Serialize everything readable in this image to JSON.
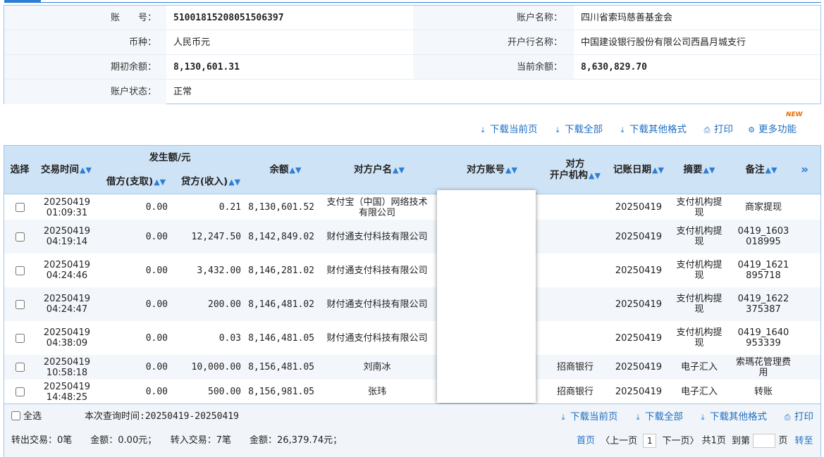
{
  "account_info": {
    "account_no_label": "账　　号：",
    "account_no": "51001815208051506397",
    "account_name_label": "账户名称：",
    "account_name": "四川省索玛慈善基金会",
    "currency_label": "币种：",
    "currency": "人民币元",
    "bank_label": "开户行名称：",
    "bank": "中国建设银行股份有限公司西昌月城支行",
    "opening_balance_label": "期初余额：",
    "opening_balance": "8,130,601.31",
    "current_balance_label": "当前余额：",
    "current_balance": "8,630,829.70",
    "status_label": "账户状态：",
    "status": "正常"
  },
  "toolbar_top": {
    "download_page": "下载当前页",
    "download_all": "下载全部",
    "download_other": "下载其他格式",
    "print": "打印",
    "more": "更多功能",
    "new_badge": "NEW"
  },
  "table": {
    "headers": {
      "select": "选择",
      "time": "交易时间",
      "amount_group": "发生额/元",
      "debit": "借方(支取)",
      "credit": "贷方(收入)",
      "balance": "余额",
      "counterparty": "对方户名",
      "counter_account": "对方账号",
      "counter_bank_1": "对方",
      "counter_bank_2": "开户机构",
      "post_date": "记账日期",
      "summary": "摘要",
      "remark": "备注"
    },
    "rows": [
      {
        "date": "20250419",
        "time": "01:09:31",
        "debit": "0.00",
        "credit": "0.21",
        "balance": "8,130,601.52",
        "counterparty": "支付宝（中国）网络技术有限公司",
        "bank": "",
        "post_date": "20250419",
        "summary": "支付机构提现",
        "remark": "商家提现"
      },
      {
        "date": "20250419",
        "time": "04:19:14",
        "debit": "0.00",
        "credit": "12,247.50",
        "balance": "8,142,849.02",
        "counterparty": "财付通支付科技有限公司",
        "bank": "",
        "post_date": "20250419",
        "summary": "支付机构提现",
        "remark": "0419_1603018995"
      },
      {
        "date": "20250419",
        "time": "04:24:46",
        "debit": "0.00",
        "credit": "3,432.00",
        "balance": "8,146,281.02",
        "counterparty": "财付通支付科技有限公司",
        "bank": "",
        "post_date": "20250419",
        "summary": "支付机构提现",
        "remark": "0419_1621895718"
      },
      {
        "date": "20250419",
        "time": "04:24:47",
        "debit": "0.00",
        "credit": "200.00",
        "balance": "8,146,481.02",
        "counterparty": "财付通支付科技有限公司",
        "bank": "",
        "post_date": "20250419",
        "summary": "支付机构提现",
        "remark": "0419_1622375387"
      },
      {
        "date": "20250419",
        "time": "04:38:09",
        "debit": "0.00",
        "credit": "0.03",
        "balance": "8,146,481.05",
        "counterparty": "财付通支付科技有限公司",
        "bank": "",
        "post_date": "20250419",
        "summary": "支付机构提现",
        "remark": "0419_1640953339"
      },
      {
        "date": "20250419",
        "time": "10:58:18",
        "debit": "0.00",
        "credit": "10,000.00",
        "balance": "8,156,481.05",
        "counterparty": "刘南冰",
        "bank": "招商银行",
        "post_date": "20250419",
        "summary": "电子汇入",
        "remark": "索瑪花管理费用"
      },
      {
        "date": "20250419",
        "time": "14:48:25",
        "debit": "0.00",
        "credit": "500.00",
        "balance": "8,156,981.05",
        "counterparty": "张玮",
        "bank": "招商银行",
        "post_date": "20250419",
        "summary": "电子汇入",
        "remark": "转账"
      }
    ]
  },
  "footer": {
    "select_all": "全选",
    "query_time": "本次查询时间:20250419-20250419",
    "download_page": "下载当前页",
    "download_all": "下载全部",
    "download_other": "下载其他格式",
    "print": "打印",
    "summary": "转出交易：0笔　　金额：0.00元；　　转入交易：7笔　　金额：26,379.74元；",
    "first": "首页",
    "prev": "〈上一页",
    "current_page": "1",
    "next": "下一页〉",
    "total_pages": "共1页",
    "goto": "到第",
    "page_unit": "页",
    "go": "转至"
  }
}
